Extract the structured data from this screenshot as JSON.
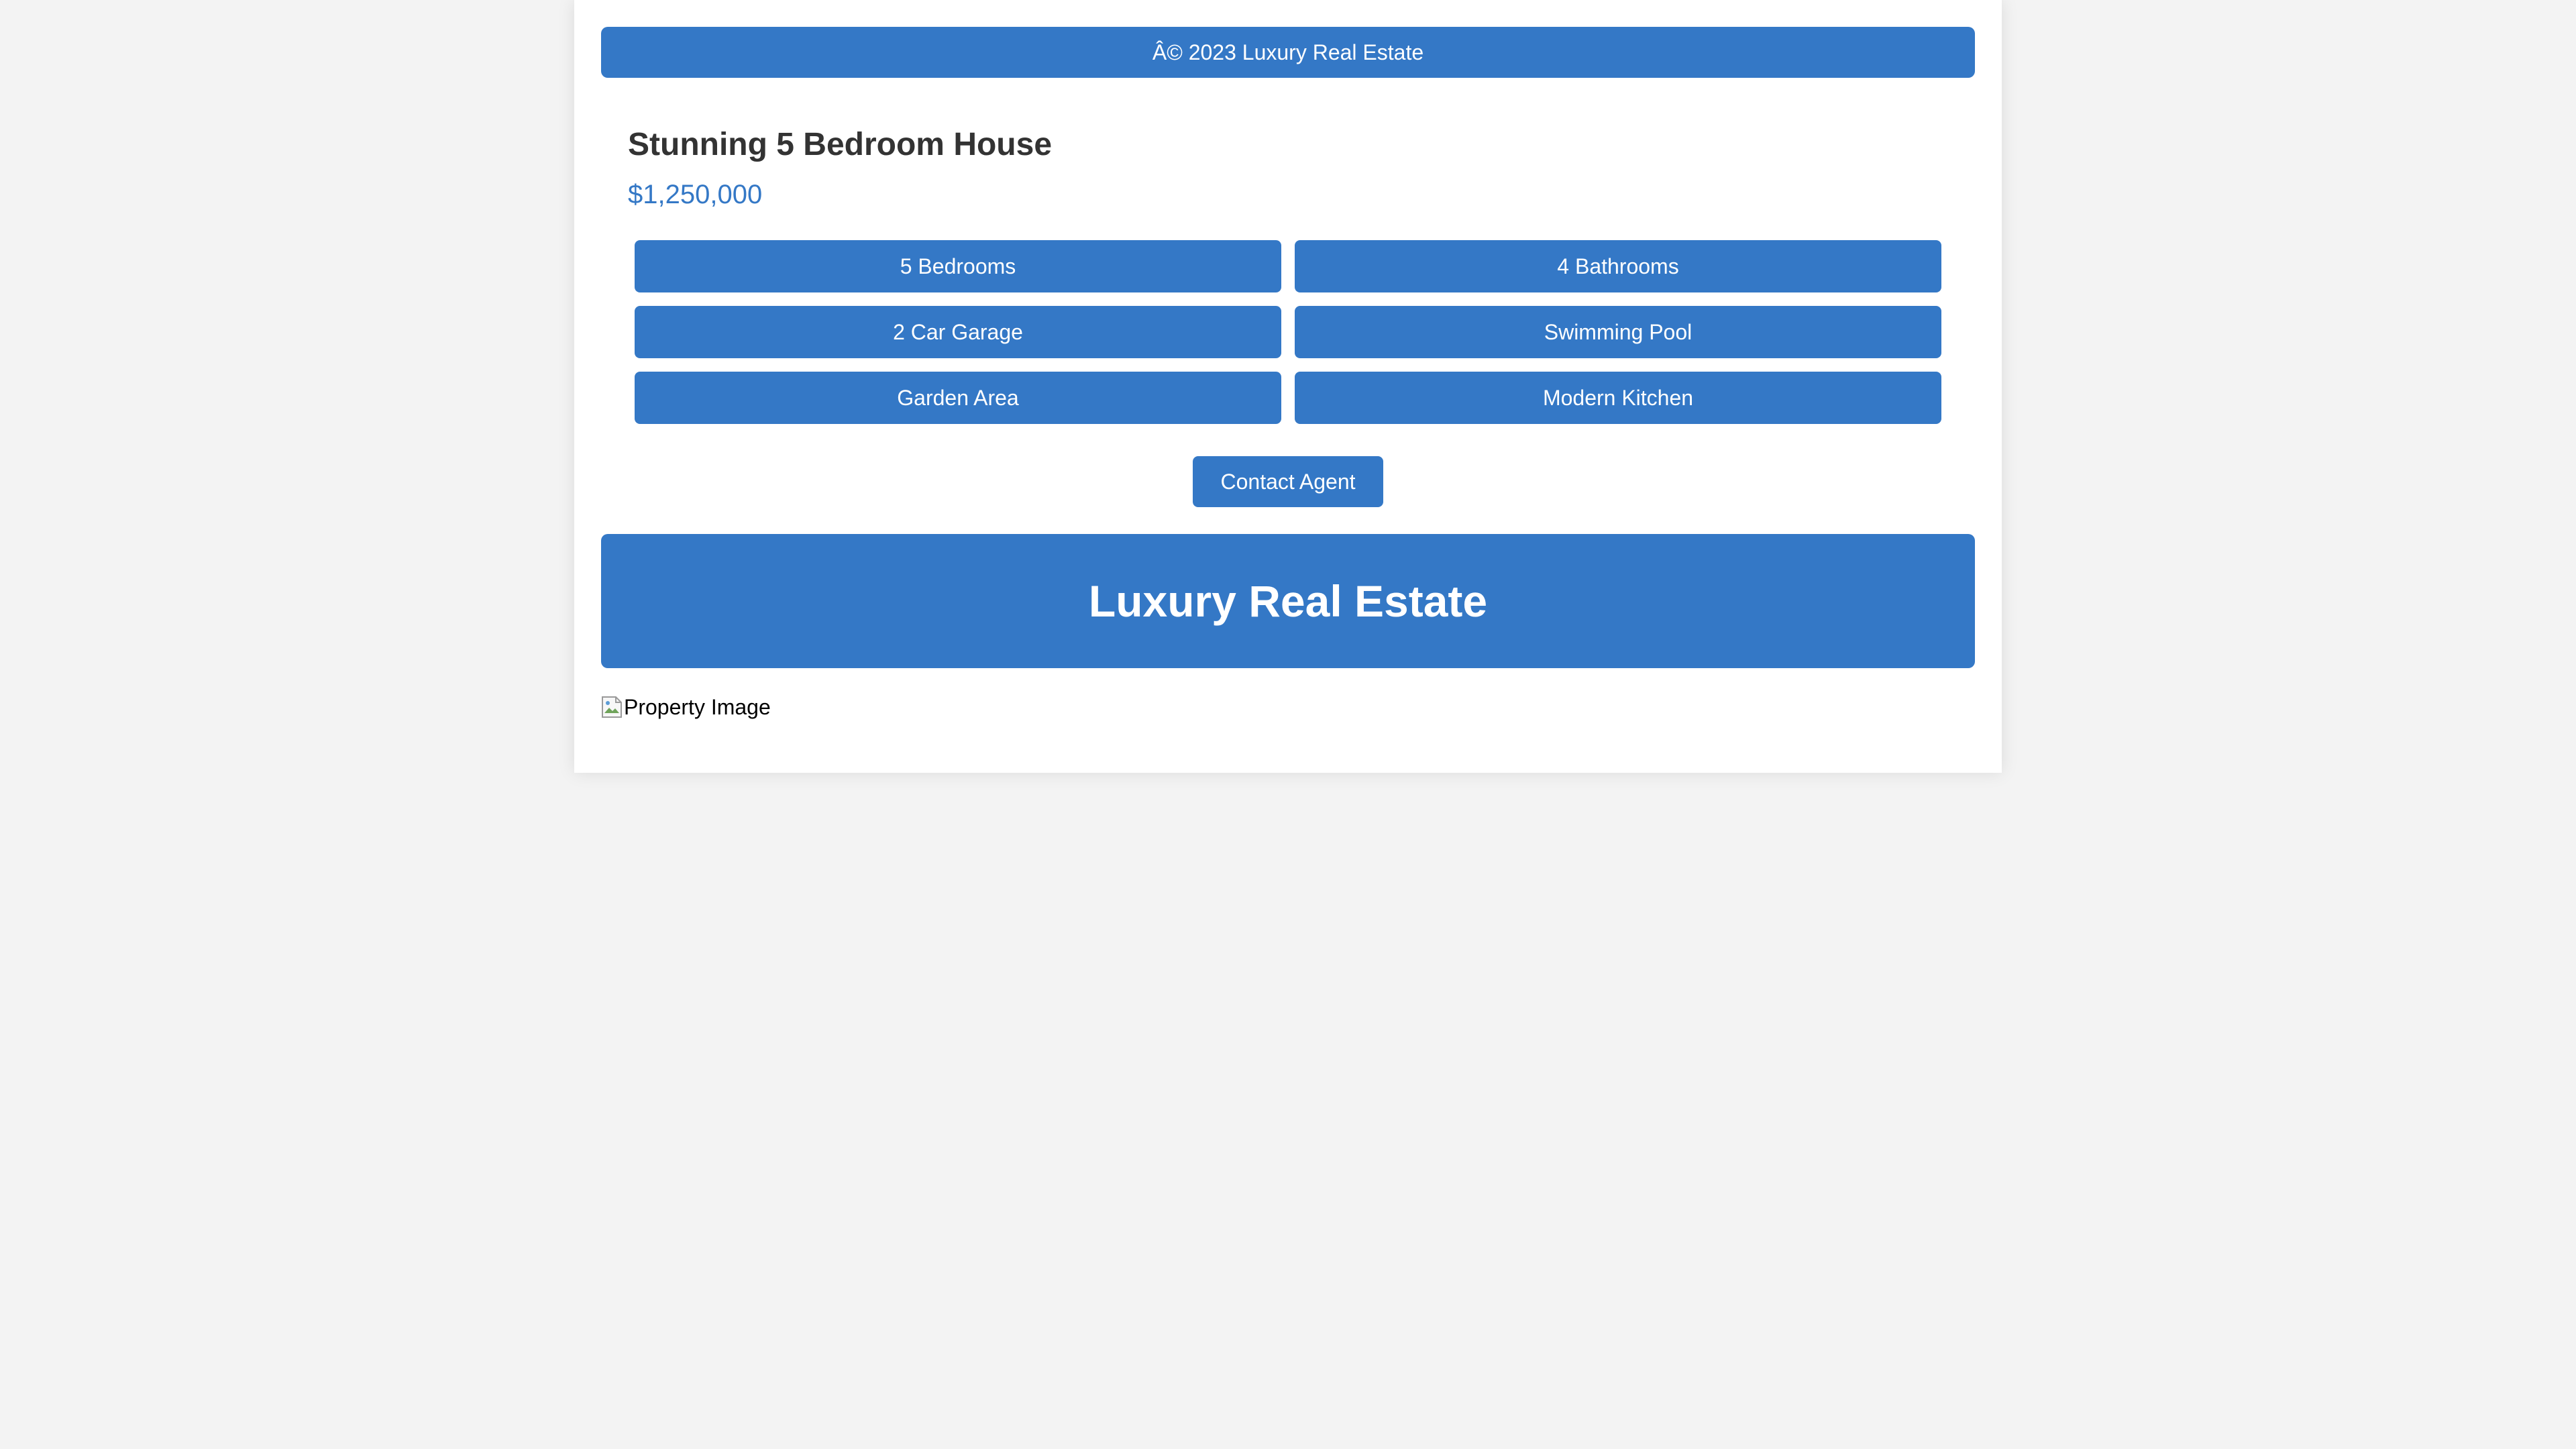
{
  "footer": {
    "copyright": "Â© 2023 Luxury Real Estate"
  },
  "property": {
    "title": "Stunning 5 Bedroom House",
    "price": "$1,250,000",
    "features": [
      "5 Bedrooms",
      "4 Bathrooms",
      "2 Car Garage",
      "Swimming Pool",
      "Garden Area",
      "Modern Kitchen"
    ],
    "contact_label": "Contact Agent",
    "image_alt": "Property Image"
  },
  "header": {
    "title": "Luxury Real Estate"
  },
  "colors": {
    "accent": "#3478c6",
    "background": "#f3f3f3",
    "card": "#ffffff",
    "heading": "#333333"
  },
  "icons": {
    "image_placeholder": "broken-image-icon"
  }
}
